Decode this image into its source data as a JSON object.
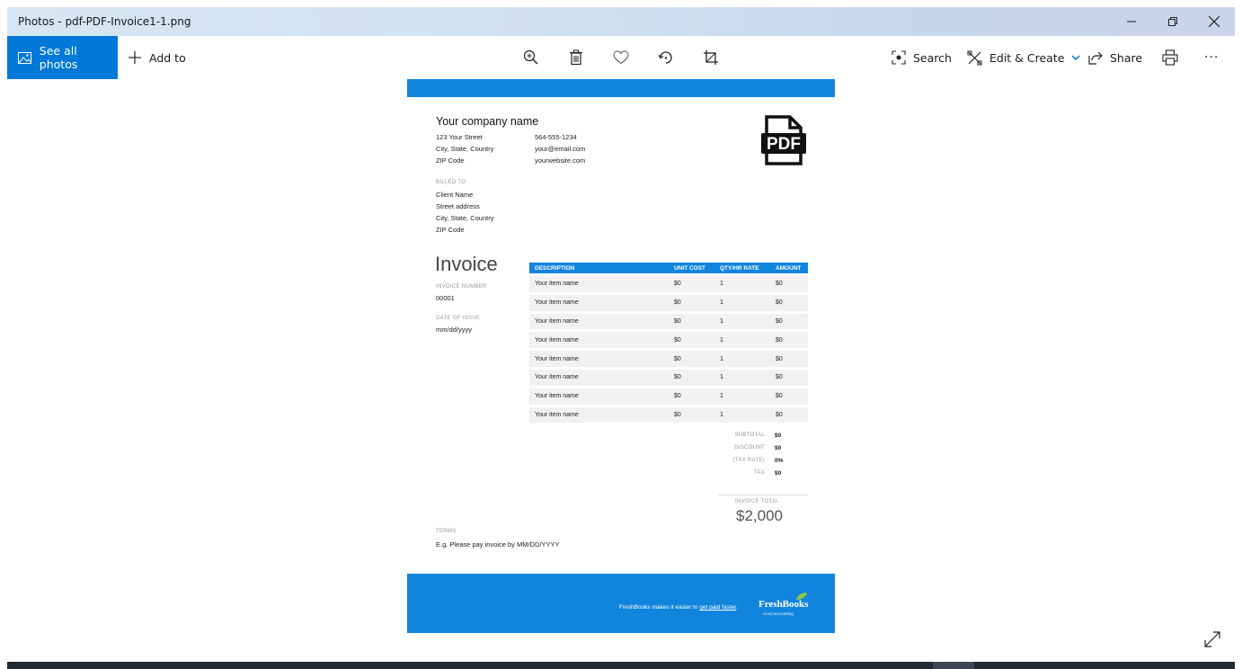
{
  "window": {
    "title": "Photos - pdf-PDF-Invoice1-1.png"
  },
  "toolbar": {
    "see_all": "See all photos",
    "add_to": "Add to",
    "search": "Search",
    "edit_create": "Edit & Create",
    "share": "Share",
    "more": "···",
    "accent_color": "#0078d7"
  },
  "invoice": {
    "company_name": "Your company name",
    "address": [
      "123 Your Street",
      "City, State, Country",
      "ZIP Code"
    ],
    "contact": [
      "564-555-1234",
      "your@email.com",
      "yourwebsite.com"
    ],
    "pdf_badge": "PDF",
    "billed_to_label": "BILLED TO",
    "billed_to": [
      "Client Name",
      "Street address",
      "City, State, Country",
      "ZIP Code"
    ],
    "heading": "Invoice",
    "invoice_number_label": "INVOICE NUMBER",
    "invoice_number": "00001",
    "date_label": "DATE OF ISSUE",
    "date": "mm/dd/yyyy",
    "columns": [
      "DESCRIPTION",
      "UNIT COST",
      "QTY/HR RATE",
      "AMOUNT"
    ],
    "rows": [
      [
        "Your item name",
        "$0",
        "1",
        "$0"
      ],
      [
        "Your item name",
        "$0",
        "1",
        "$0"
      ],
      [
        "Your item name",
        "$0",
        "1",
        "$0"
      ],
      [
        "Your item name",
        "$0",
        "1",
        "$0"
      ],
      [
        "Your item name",
        "$0",
        "1",
        "$0"
      ],
      [
        "Your item name",
        "$0",
        "1",
        "$0"
      ],
      [
        "Your item name",
        "$0",
        "1",
        "$0"
      ],
      [
        "Your item name",
        "$0",
        "1",
        "$0"
      ]
    ],
    "subtotal_label": "SUBTOTAL",
    "subtotal": "$0",
    "discount_label": "DISCOUNT",
    "discount": "$0",
    "tax_rate_label": "(TAX RATE)",
    "tax_rate": "0%",
    "tax_label": "TAX",
    "tax": "$0",
    "total_label": "INVOICE TOTAL",
    "total": "$2,000",
    "terms_label": "TERMS",
    "terms": "E.g. Please pay invoice by MM/DD/YYYY",
    "footer_text": "FreshBooks makes it easier to ",
    "footer_link": "get paid faster",
    "footer_end": ".",
    "brand": "FreshBooks",
    "brand_sub": "cloud accounting",
    "brand_color": "#1185dd"
  }
}
